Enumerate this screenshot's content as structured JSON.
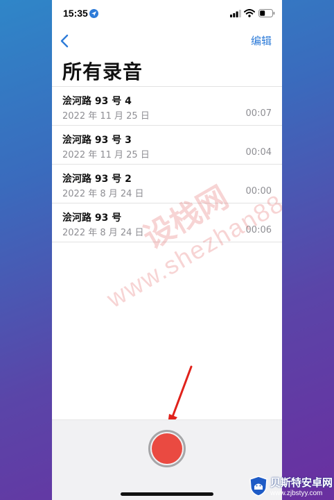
{
  "status_bar": {
    "time": "15:35"
  },
  "header": {
    "edit_label": "编辑",
    "title": "所有录音"
  },
  "recordings": [
    {
      "title": "浍河路 93 号 4",
      "date": "2022 年 11 月 25 日",
      "duration": "00:07"
    },
    {
      "title": "浍河路 93 号 3",
      "date": "2022 年 11 月 25 日",
      "duration": "00:04"
    },
    {
      "title": "浍河路 93 号 2",
      "date": "2022 年 8 月 24 日",
      "duration": "00:00"
    },
    {
      "title": "浍河路 93 号",
      "date": "2022 年 8 月 24 日",
      "duration": "00:06"
    }
  ],
  "watermark": {
    "cn": "设栈网",
    "en": "www.shezhan88.com"
  },
  "brand": {
    "name": "贝斯特安卓网",
    "url": "www.zjbstyy.com"
  },
  "colors": {
    "accent": "#2d7bd8",
    "record": "#ea4a41",
    "annotation_arrow": "#e0221b"
  }
}
